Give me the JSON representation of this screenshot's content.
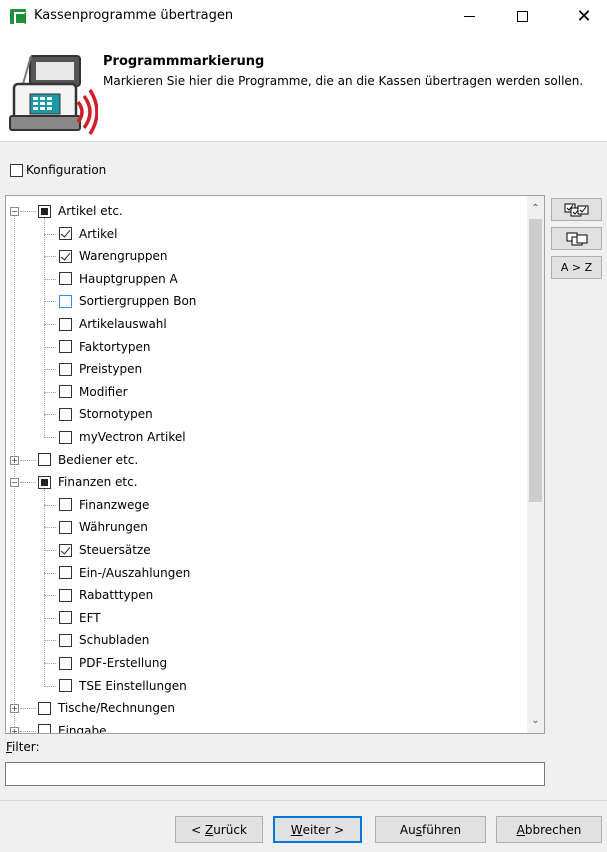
{
  "window": {
    "title": "Kassenprogramme übertragen"
  },
  "header": {
    "title": "Programmmarkierung",
    "description": "Markieren Sie hier die Programme, die an die Kassen übertragen werden sollen."
  },
  "konfiguration": {
    "label": "Konfiguration",
    "checked": false
  },
  "tree": {
    "groups": [
      {
        "label": "Artikel etc.",
        "state": "partial",
        "expanded": true,
        "children": [
          {
            "label": "Artikel",
            "checked": true
          },
          {
            "label": "Warengruppen",
            "checked": true
          },
          {
            "label": "Hauptgruppen A",
            "checked": false
          },
          {
            "label": "Sortiergruppen Bon",
            "checked": false
          },
          {
            "label": "Artikelauswahl",
            "checked": false
          },
          {
            "label": "Faktortypen",
            "checked": false
          },
          {
            "label": "Preistypen",
            "checked": false
          },
          {
            "label": "Modifier",
            "checked": false
          },
          {
            "label": "Stornotypen",
            "checked": false
          },
          {
            "label": "myVectron Artikel",
            "checked": false
          }
        ]
      },
      {
        "label": "Bediener etc.",
        "state": "unchecked",
        "expanded": false,
        "children": []
      },
      {
        "label": "Finanzen etc.",
        "state": "partial",
        "expanded": true,
        "children": [
          {
            "label": "Finanzwege",
            "checked": false
          },
          {
            "label": "Währungen",
            "checked": false
          },
          {
            "label": "Steuersätze",
            "checked": true
          },
          {
            "label": "Ein-/Auszahlungen",
            "checked": false
          },
          {
            "label": "Rabatttypen",
            "checked": false
          },
          {
            "label": "EFT",
            "checked": false
          },
          {
            "label": "Schubladen",
            "checked": false
          },
          {
            "label": "PDF-Erstellung",
            "checked": false
          },
          {
            "label": "TSE Einstellungen",
            "checked": false
          }
        ]
      },
      {
        "label": "Tische/Rechnungen",
        "state": "unchecked",
        "expanded": false,
        "children": []
      },
      {
        "label": "Eingabe",
        "state": "unchecked",
        "expanded": false,
        "children": []
      }
    ]
  },
  "side_buttons": {
    "check_all_icon": "check-all-icon",
    "uncheck_all_icon": "uncheck-all-icon",
    "sort_label": "A > Z"
  },
  "filter": {
    "label_rest": "ilter:",
    "label_access": "F",
    "value": ""
  },
  "buttons": {
    "back_prefix": "< ",
    "back_access": "Z",
    "back_rest": "urück",
    "next_access": "W",
    "next_rest": "eiter >",
    "run_prefix": "Au",
    "run_access": "s",
    "run_rest": "führen",
    "cancel_access": "A",
    "cancel_rest": "bbrechen"
  }
}
